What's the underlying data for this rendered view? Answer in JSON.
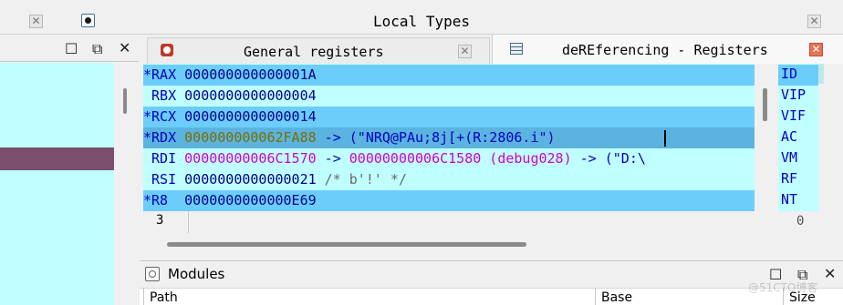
{
  "top": {
    "title": "Local Types"
  },
  "tabs": [
    {
      "label": "General registers"
    },
    {
      "label": "deREferencing - Registers"
    }
  ],
  "registers": [
    {
      "mark": "*",
      "name": "RAX",
      "value": "000000000000001A",
      "rest": ""
    },
    {
      "mark": " ",
      "name": "RBX",
      "value": "0000000000000004",
      "rest": ""
    },
    {
      "mark": "*",
      "name": "RCX",
      "value": "0000000000000014",
      "rest": ""
    },
    {
      "mark": "*",
      "name": "RDX",
      "value": "000000000062FA88",
      "arrow": " -> ",
      "target": "(\"NRQ@PAu;8j[+(R:2806.i\")"
    },
    {
      "mark": " ",
      "name": "RDI",
      "value": "00000000006C1570",
      "arrow": " -> ",
      "target": "00000000006C1580",
      "seg": " (debug028)",
      "arrow2": " -> ",
      "tail": "(\"D:\\"
    },
    {
      "mark": " ",
      "name": "RSI",
      "value": "0000000000000021",
      "comment": " /* b'!' */"
    },
    {
      "mark": "*",
      "name": "R8 ",
      "value": "0000000000000E69",
      "rest": ""
    }
  ],
  "line_number": "3",
  "flags": [
    "ID",
    "VIP",
    "VIF",
    "AC",
    "VM",
    "RF",
    "NT"
  ],
  "flags_line_number": "0",
  "modules": {
    "title": "Modules",
    "columns": [
      "Path",
      "Base",
      "Size"
    ]
  },
  "watermark": "@51CTO博客",
  "colors": {
    "register_bg": "#c0ffff",
    "highlight": "#6ccdfb",
    "value_blue": "#00008b",
    "pointer_olive": "#7c6f00",
    "pointer_magenta": "#d000c8"
  }
}
